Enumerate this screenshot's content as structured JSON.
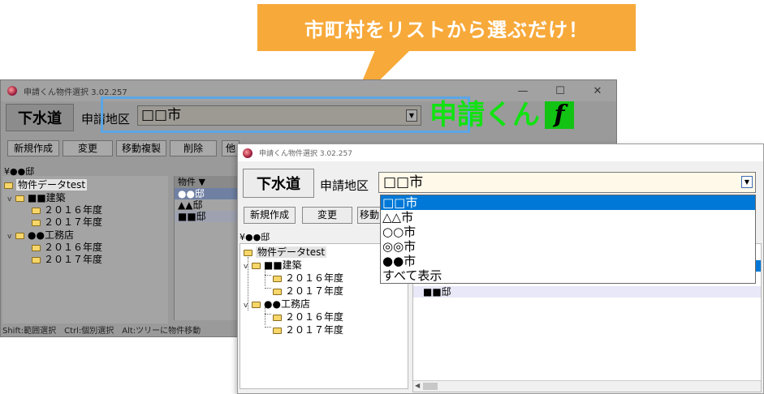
{
  "callout": {
    "text": "市町村をリストから選ぶだけ！",
    "color": "#f7a93a"
  },
  "window": {
    "title": "申請くん物件選択 3.02.257",
    "kind_button": "下水道",
    "district_label": "申請地区",
    "district_value": "□□市",
    "logo_text": "申請くん",
    "logo_f": "f",
    "controls": {
      "minimize": "—",
      "maximize": "☐",
      "close": "✕"
    }
  },
  "toolbar_back": [
    "新規作成",
    "変更",
    "移動複製",
    "削除",
    "他"
  ],
  "toolbar_front": [
    "新規作成",
    "変更",
    "移動"
  ],
  "dropdown": {
    "options": [
      "□□市",
      "△△市",
      "○○市",
      "◎◎市",
      "●●市",
      "すべて表示"
    ],
    "selected_index": 0
  },
  "path_label": "¥●●邸",
  "tree": {
    "root": "物件データtest",
    "groups": [
      {
        "name": "■■建築",
        "children": [
          "２０１６年度",
          "２０１７年度"
        ]
      },
      {
        "name": "●●工務店",
        "children": [
          "２０１６年度",
          "２０１７年度"
        ]
      }
    ]
  },
  "list": {
    "header": "物件 ▼",
    "items": [
      "●●邸",
      "▲▲邸",
      "■■邸"
    ]
  },
  "front_list_row": "■■邸",
  "status": "Shift:範囲選択　Ctrl:個別選択　Alt:ツリーに物件移動"
}
